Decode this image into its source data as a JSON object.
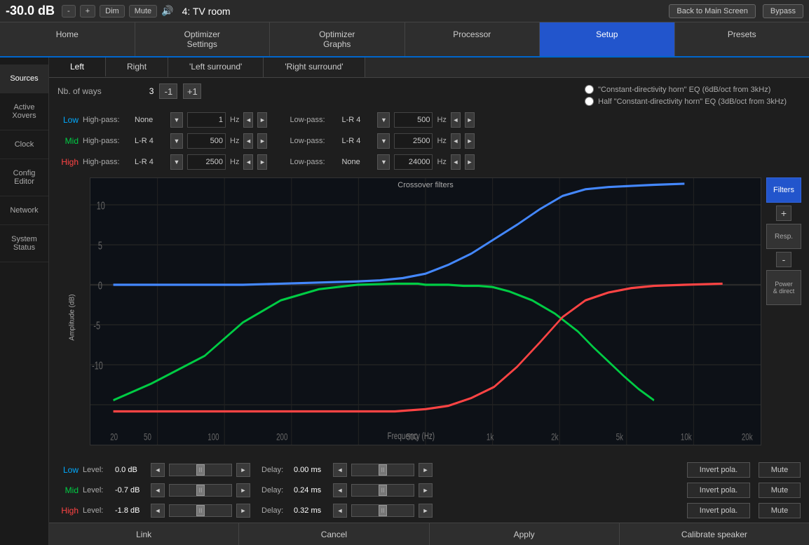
{
  "topbar": {
    "db_value": "-30.0 dB",
    "dim_label": "Dim",
    "mute_label": "Mute",
    "zone": "4: TV room",
    "back_btn": "Back to Main Screen",
    "bypass_btn": "Bypass",
    "minus_label": "-",
    "plus_label": "+"
  },
  "nav": {
    "tabs": [
      {
        "label": "Home",
        "active": false
      },
      {
        "label": "Optimizer\nSettings",
        "active": false
      },
      {
        "label": "Optimizer\nGraphs",
        "active": false
      },
      {
        "label": "Processor",
        "active": false
      },
      {
        "label": "Setup",
        "active": true
      },
      {
        "label": "Presets",
        "active": false
      }
    ]
  },
  "sidebar": {
    "items": [
      {
        "label": "Sources",
        "active": true
      },
      {
        "label": "Active\nXovers",
        "active": false
      },
      {
        "label": "Clock",
        "active": false
      },
      {
        "label": "Config\nEditor",
        "active": false
      },
      {
        "label": "Network",
        "active": false
      },
      {
        "label": "System\nStatus",
        "active": false
      }
    ]
  },
  "sub_tabs": {
    "tabs": [
      {
        "label": "Left",
        "active": true
      },
      {
        "label": "Right",
        "active": false
      },
      {
        "label": "'Left surround'",
        "active": false
      },
      {
        "label": "'Right surround'",
        "active": false
      }
    ]
  },
  "ways": {
    "label": "Nb. of ways",
    "value": "3",
    "minus_label": "-1",
    "plus_label": "+1"
  },
  "eq_options": {
    "opt1": "\"Constant-directivity horn\" EQ (6dB/oct from 3kHz)",
    "opt2": "Half \"Constant-directivity horn\" EQ (3dB/oct from 3kHz)"
  },
  "crossovers": [
    {
      "band": "Low",
      "band_color": "low",
      "hp_label": "High-pass:",
      "hp_filter": "None",
      "hp_freq": "1",
      "hp_unit": "Hz",
      "lp_label": "Low-pass:",
      "lp_filter": "L-R 4",
      "lp_freq": "500",
      "lp_unit": "Hz"
    },
    {
      "band": "Mid",
      "band_color": "mid",
      "hp_label": "High-pass:",
      "hp_filter": "L-R 4",
      "hp_freq": "500",
      "hp_unit": "Hz",
      "lp_label": "Low-pass:",
      "lp_filter": "L-R 4",
      "lp_freq": "2500",
      "lp_unit": "Hz"
    },
    {
      "band": "High",
      "band_color": "high",
      "hp_label": "High-pass:",
      "hp_filter": "L-R 4",
      "hp_freq": "2500",
      "hp_unit": "Hz",
      "lp_label": "Low-pass:",
      "lp_filter": "None",
      "lp_freq": "24000",
      "lp_unit": "Hz"
    }
  ],
  "graph": {
    "title": "Crossover filters",
    "y_label": "Amplitude (dB)",
    "x_label": "Frequency (Hz)",
    "y_ticks": [
      "10",
      "5",
      "0",
      "-5",
      "-10"
    ],
    "x_ticks": [
      "20",
      "50",
      "100",
      "200",
      "500",
      "1k",
      "2k",
      "5k",
      "10k",
      "20k"
    ]
  },
  "graph_buttons": {
    "filters": "Filters",
    "plus": "+",
    "resp": "Resp.",
    "minus": "-",
    "power": "Power\n& direct"
  },
  "levels": [
    {
      "band": "Low",
      "band_color": "low",
      "level_label": "Level:",
      "level_value": "0.0 dB",
      "delay_label": "Delay:",
      "delay_value": "0.00 ms",
      "invert_label": "Invert pola.",
      "mute_label": "Mute"
    },
    {
      "band": "Mid",
      "band_color": "mid",
      "level_label": "Level:",
      "level_value": "-0.7 dB",
      "delay_label": "Delay:",
      "delay_value": "0.24 ms",
      "invert_label": "Invert pola.",
      "mute_label": "Mute"
    },
    {
      "band": "High",
      "band_color": "high",
      "level_label": "Level:",
      "level_value": "-1.8 dB",
      "delay_label": "Delay:",
      "delay_value": "0.32 ms",
      "invert_label": "Invert pola.",
      "mute_label": "Mute"
    }
  ],
  "bottom_buttons": {
    "link": "Link",
    "cancel": "Cancel",
    "apply": "Apply",
    "calibrate": "Calibrate speaker"
  }
}
